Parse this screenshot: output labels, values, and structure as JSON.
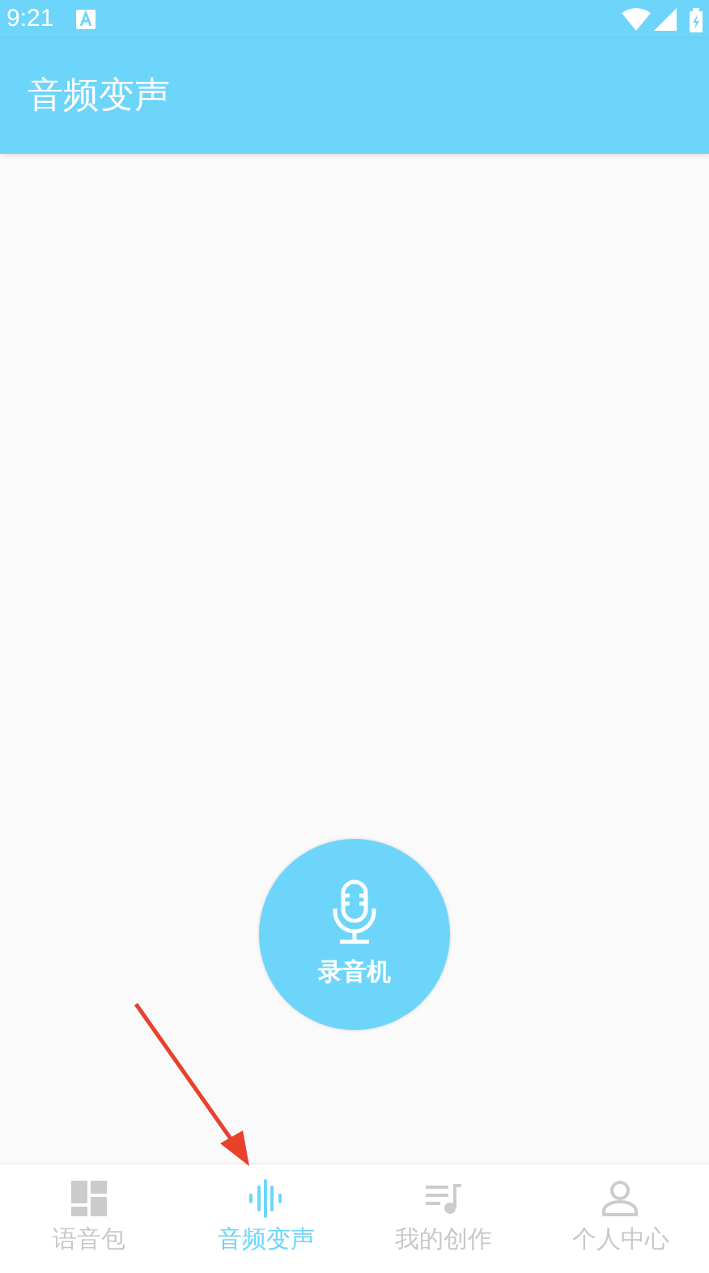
{
  "status_bar": {
    "time": "9:21"
  },
  "app_bar": {
    "title": "音频变声"
  },
  "record_button": {
    "label": "录音机"
  },
  "bottom_nav": [
    {
      "label": "语音包",
      "kind": "grid",
      "selected": false
    },
    {
      "label": "音频变声",
      "kind": "wave",
      "selected": true
    },
    {
      "label": "我的创作",
      "kind": "playlist",
      "selected": false
    },
    {
      "label": "个人中心",
      "kind": "person",
      "selected": false
    }
  ]
}
